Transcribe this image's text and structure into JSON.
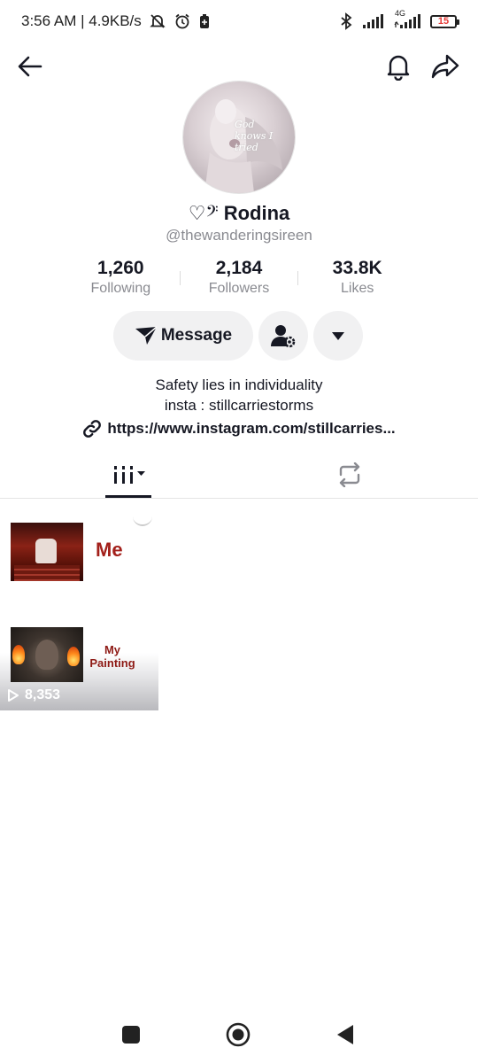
{
  "status_bar": {
    "time_speed": "3:56 AM | 4.9KB/s",
    "network_label": "4G",
    "battery_level": "15"
  },
  "profile": {
    "emoji": "♡𝄢",
    "display_name": "Rodina",
    "username": "@thewanderingsireen",
    "avatar_text": "God knows I tried"
  },
  "stats": [
    {
      "value": "1,260",
      "label": "Following"
    },
    {
      "value": "2,184",
      "label": "Followers"
    },
    {
      "value": "33.8K",
      "label": "Likes"
    }
  ],
  "actions": {
    "message_label": "Message"
  },
  "bio": {
    "line1": "Safety lies in individuality",
    "line2": "insta : stillcarriestorms",
    "link": "https://www.instagram.com/stillcarries..."
  },
  "posts": [
    {
      "title": "Me"
    },
    {
      "title": "My Painting",
      "views": "8,353"
    }
  ]
}
